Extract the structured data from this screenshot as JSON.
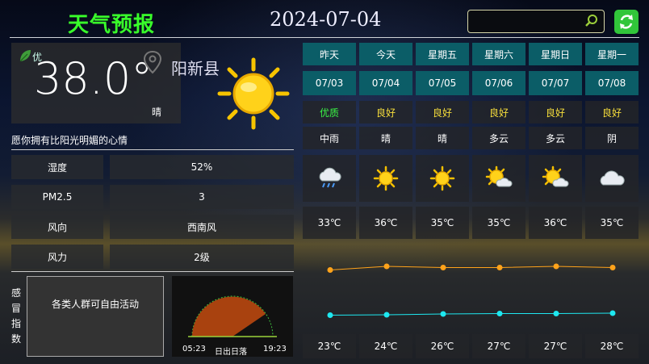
{
  "header": {
    "title": "天气预报",
    "date": "2024-07-04",
    "search_placeholder": "",
    "search_value": ""
  },
  "current": {
    "aqi": "优",
    "temperature": "38.0°",
    "condition": "晴",
    "city": "阳新县",
    "tip": "愿你拥有比阳光明媚的心情"
  },
  "details": [
    {
      "label": "湿度",
      "value": "52%"
    },
    {
      "label": "PM2.5",
      "value": "3"
    },
    {
      "label": "风向",
      "value": "西南风"
    },
    {
      "label": "风力",
      "value": "2级"
    }
  ],
  "index": {
    "label": "感冒指数",
    "advice": "各类人群可自由活动"
  },
  "sun": {
    "rise": "05:23",
    "label": "日出日落",
    "set": "19:23"
  },
  "forecast": [
    {
      "day": "昨天",
      "date": "07/03",
      "quality": "优质",
      "weather": "中雨",
      "icon": "rain-cloud-icon",
      "high": "33℃",
      "low": "23℃"
    },
    {
      "day": "今天",
      "date": "07/04",
      "quality": "良好",
      "weather": "晴",
      "icon": "sun-icon",
      "high": "36℃",
      "low": "24℃"
    },
    {
      "day": "星期五",
      "date": "07/05",
      "quality": "良好",
      "weather": "晴",
      "icon": "sun-icon",
      "high": "35℃",
      "low": "26℃"
    },
    {
      "day": "星期六",
      "date": "07/06",
      "quality": "良好",
      "weather": "多云",
      "icon": "partly-cloudy-icon",
      "high": "35℃",
      "low": "27℃"
    },
    {
      "day": "星期日",
      "date": "07/07",
      "quality": "良好",
      "weather": "多云",
      "icon": "partly-cloudy-icon",
      "high": "36℃",
      "low": "27℃"
    },
    {
      "day": "星期一",
      "date": "07/08",
      "quality": "良好",
      "weather": "阴",
      "icon": "cloud-icon",
      "high": "35℃",
      "low": "28℃"
    }
  ],
  "chart_data": {
    "type": "line",
    "categories": [
      "07/03",
      "07/04",
      "07/05",
      "07/06",
      "07/07",
      "07/08"
    ],
    "series": [
      {
        "values": [
          33,
          36,
          35,
          35,
          36,
          35
        ],
        "color": "#ffa31a"
      },
      {
        "values": [
          23,
          24,
          26,
          27,
          27,
          28
        ],
        "color": "#1ee8f0"
      }
    ]
  },
  "colors": {
    "title": "#39ff2a",
    "header_row": "#0b5d67",
    "quality_good": "#f7de3b",
    "quality_best": "#3bf545",
    "high_line": "#ffa31a",
    "low_line": "#1ee8f0",
    "refresh": "#31c63a"
  }
}
